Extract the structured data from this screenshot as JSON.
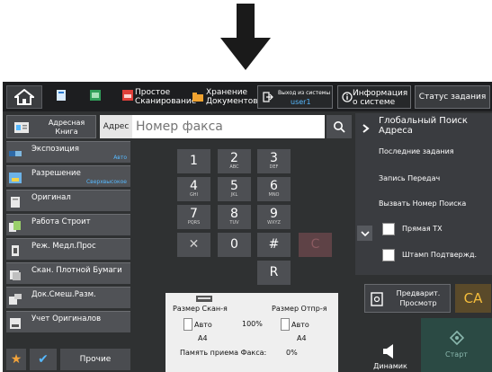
{
  "topbar": {
    "tab_simple_scan": "Простое\nСканирование",
    "tab_doc_storage": "Хранение\nДокументов",
    "logout_label": "Выход из системы",
    "user_name": "user1",
    "system_info": "Информация\nо системе",
    "job_status": "Статус задания"
  },
  "address": {
    "book_label": "Адресная\nКнига",
    "address_label": "Адрес",
    "fax_placeholder": "Номер факса"
  },
  "left_menu": [
    {
      "label": "Экспозиция",
      "value": "Авто"
    },
    {
      "label": "Разрешение",
      "value": "Сверхвысокое"
    },
    {
      "label": "Оригинал",
      "value": ""
    },
    {
      "label": "Работа Строит",
      "value": ""
    },
    {
      "label": "Реж. Медл.Проc",
      "value": ""
    },
    {
      "label": "Скан. Плотной Бумаги",
      "value": ""
    },
    {
      "label": "Док.Смеш.Разм.",
      "value": ""
    },
    {
      "label": "Учет Оригиналов",
      "value": ""
    }
  ],
  "bottom_left": {
    "other_label": "Прочие"
  },
  "keypad": {
    "keys": [
      {
        "main": "1",
        "sub": ""
      },
      {
        "main": "2",
        "sub": "ABC"
      },
      {
        "main": "3",
        "sub": "DEF"
      },
      {
        "main": "4",
        "sub": "GHI"
      },
      {
        "main": "5",
        "sub": "JKL"
      },
      {
        "main": "6",
        "sub": "MNO"
      },
      {
        "main": "7",
        "sub": "PQRS"
      },
      {
        "main": "8",
        "sub": "TUV"
      },
      {
        "main": "9",
        "sub": "WXYZ"
      },
      {
        "main": "✕",
        "sub": ""
      },
      {
        "main": "0",
        "sub": ""
      },
      {
        "main": "#",
        "sub": ""
      },
      {
        "main": "C",
        "sub": ""
      },
      {
        "main": "R",
        "sub": ""
      }
    ]
  },
  "scan_info": {
    "scan_size_label": "Размер Скан-я",
    "send_size_label": "Размер Отпр-я",
    "ratio": "100%",
    "scan_mode": "Авто",
    "scan_paper": "A4",
    "send_mode": "Авто",
    "send_paper": "A4",
    "fax_memory_label": "Память приема Факса:",
    "fax_memory_value": "0%"
  },
  "right_panel": {
    "global_search": "Глобальный Поиск Адреса",
    "recent_jobs": "Последние задания",
    "tx_record": "Запись Передач",
    "call_search": "Вызвать Номер Поиска",
    "direct_tx": "Прямая ТХ",
    "verify_stamp": "Штамп Подтвержд."
  },
  "actions": {
    "preview": "Предварит.\nПросмотр",
    "ca": "CA",
    "speaker": "Динамик",
    "start": "Старт"
  },
  "colors": {
    "accent_blue": "#56b9ff",
    "ca_yellow": "#f5bd3b",
    "start_green": "#2b4a44"
  }
}
